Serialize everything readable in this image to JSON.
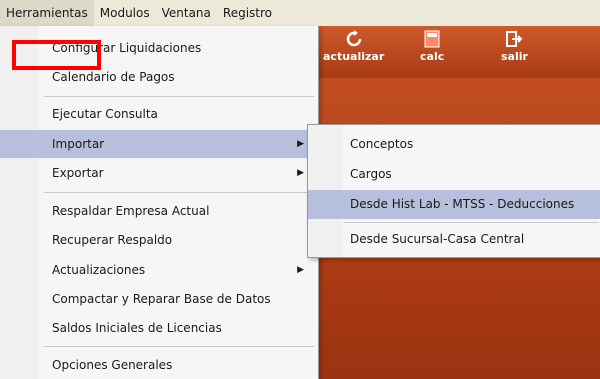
{
  "menubar": {
    "items": [
      "Herramientas",
      "Modulos",
      "Ventana",
      "Registro"
    ]
  },
  "toolbar": {
    "buttons": [
      {
        "label": "actualizar",
        "icon": "refresh-icon"
      },
      {
        "label": "calc",
        "icon": "calculator-icon"
      },
      {
        "label": "salir",
        "icon": "exit-icon"
      }
    ]
  },
  "menu": {
    "items": [
      {
        "label": "Configurar Liquidaciones"
      },
      {
        "label": "Calendario de Pagos"
      },
      {
        "label": "Ejecutar Consulta"
      },
      {
        "label": "Importar",
        "submenu": true,
        "highlighted": true
      },
      {
        "label": "Exportar",
        "submenu": true
      },
      {
        "label": "Respaldar Empresa Actual"
      },
      {
        "label": "Recuperar Respaldo"
      },
      {
        "label": "Actualizaciones",
        "submenu": true
      },
      {
        "label": "Compactar y Reparar  Base de Datos"
      },
      {
        "label": "Saldos Iniciales de Licencias"
      },
      {
        "label": "Opciones Generales"
      }
    ]
  },
  "submenu": {
    "items": [
      {
        "label": "Conceptos"
      },
      {
        "label": "Cargos"
      },
      {
        "label": "Desde Hist Lab - MTSS - Deducciones",
        "highlighted": true
      },
      {
        "label": "Desde Sucursal-Casa Central"
      }
    ]
  },
  "colors": {
    "menu_highlight": "#b6bfdc",
    "app_accent": "#b8441a",
    "annotation_box": "#ff0000"
  }
}
